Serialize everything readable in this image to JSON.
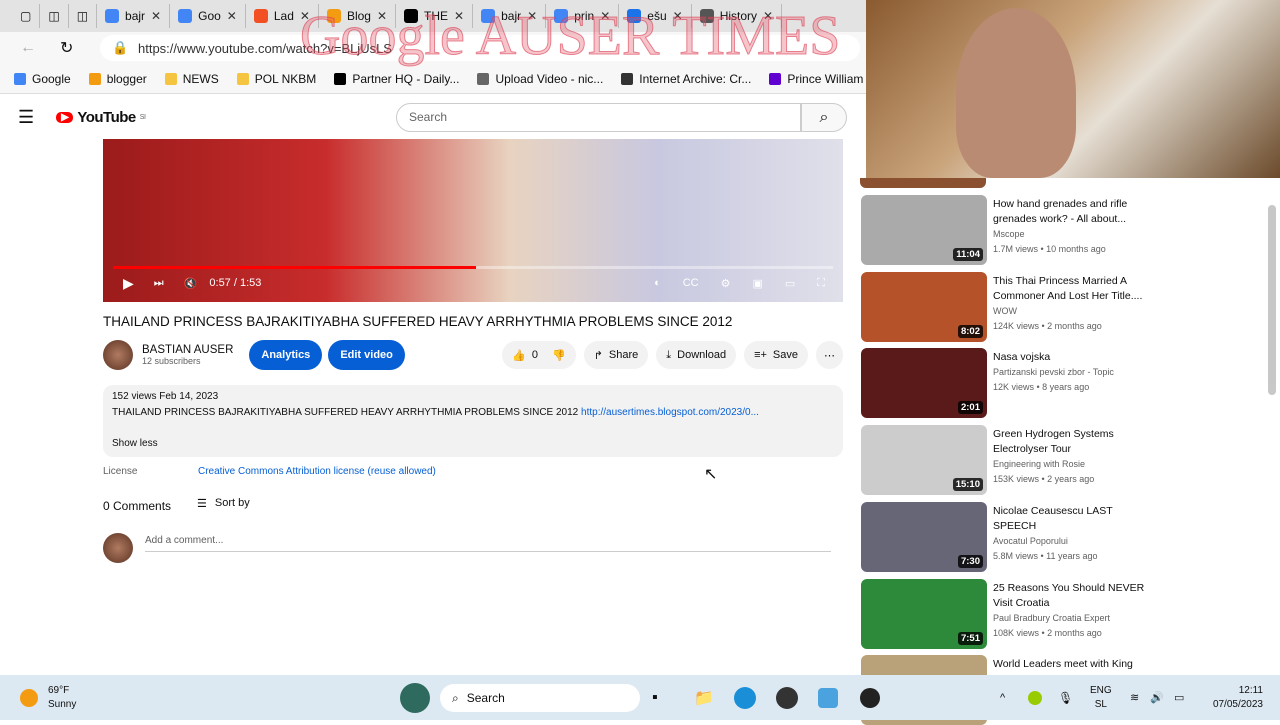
{
  "browser": {
    "tabs": [
      {
        "label": "bajr",
        "color": "#4285f4"
      },
      {
        "label": "Goo",
        "color": "#4285f4"
      },
      {
        "label": "Lad",
        "color": "#f25022"
      },
      {
        "label": "Blog",
        "color": "#f39c12"
      },
      {
        "label": "THE",
        "color": "#000"
      },
      {
        "label": "bajr",
        "color": "#4285f4"
      },
      {
        "label": "prin",
        "color": "#4285f4"
      },
      {
        "label": "ešu",
        "color": "#1a73e8"
      },
      {
        "label": "History",
        "color": "#555"
      }
    ],
    "url": "https://www.youtube.com/watch?v=BLjUsLS",
    "bookmarks": [
      {
        "label": "Google",
        "color": "#4285f4"
      },
      {
        "label": "blogger",
        "color": "#f39c12"
      },
      {
        "label": "NEWS",
        "color": "#f5c542"
      },
      {
        "label": "POL NKBM",
        "color": "#f5c542"
      },
      {
        "label": "Partner HQ - Daily...",
        "color": "#000"
      },
      {
        "label": "Upload Video - nic...",
        "color": "#666"
      },
      {
        "label": "Internet Archive: Cr...",
        "color": "#333"
      },
      {
        "label": "Prince William & Ka...",
        "color": "#6001d2"
      }
    ],
    "watermark": "Google AUSER TIMES"
  },
  "youtube": {
    "logo": "YouTube",
    "region": "SI",
    "search_placeholder": "Search"
  },
  "player": {
    "time": "0:57 / 1:53",
    "progress": 0.504
  },
  "video": {
    "title": "THAILAND PRINCESS BAJRAKITIYABHA SUFFERED HEAVY ARRHYTHMIA PROBLEMS SINCE 2012",
    "channel": "BASTIAN AUSER",
    "subscribers": "12 subscribers",
    "analytics": "Analytics",
    "edit": "Edit video",
    "likes": "0",
    "share": "Share",
    "download": "Download",
    "save": "Save",
    "more": "⋯",
    "views_date": "152 views  Feb 14, 2023",
    "description": "THAILAND PRINCESS BAJRAKITIYABHA SUFFERED HEAVY ARRHYTHMIA PROBLEMS SINCE 2012",
    "link": "http://ausertimes.blogspot.com/2023/0...",
    "show_less": "Show less",
    "license_label": "License",
    "license": "Creative Commons Attribution license (reuse allowed)",
    "comments": "0 Comments",
    "sort": "Sort by",
    "add_comment": "Add a comment..."
  },
  "related": [
    {
      "title": "How hand grenades and rifle grenades work? - All about...",
      "channel": "Mscope",
      "meta": "1.7M views • 10 months ago",
      "duration": "11:04",
      "color": "#aaa"
    },
    {
      "title": "This Thai Princess Married A Commoner And Lost Her Title....",
      "channel": "WOW",
      "meta": "124K views • 2 months ago",
      "duration": "8:02",
      "color": "#b5522a"
    },
    {
      "title": "Nasa vojska",
      "channel": "Partizanski pevski zbor - Topic",
      "meta": "12K views • 8 years ago",
      "duration": "2:01",
      "color": "#5a1a1a"
    },
    {
      "title": "Green Hydrogen Systems Electrolyser Tour",
      "channel": "Engineering with Rosie",
      "meta": "153K views • 2 years ago",
      "duration": "15:10",
      "color": "#ccc"
    },
    {
      "title": "Nicolae Ceausescu LAST SPEECH",
      "channel": "Avocatul Poporului",
      "meta": "5.8M views • 11 years ago",
      "duration": "7:30",
      "color": "#667"
    },
    {
      "title": "25 Reasons You Should NEVER Visit Croatia",
      "channel": "Paul Bradbury Croatia Expert",
      "meta": "108K views • 2 months ago",
      "duration": "7:51",
      "color": "#2d8a3a"
    },
    {
      "title": "World Leaders meet with King",
      "channel": "",
      "meta": "",
      "duration": "",
      "color": "#b9a27a"
    }
  ],
  "taskbar": {
    "temp": "69°F",
    "weather": "Sunny",
    "search": "Search",
    "lang": "ENG",
    "lang2": "SL",
    "time": "12:11",
    "date": "07/05/2023"
  }
}
